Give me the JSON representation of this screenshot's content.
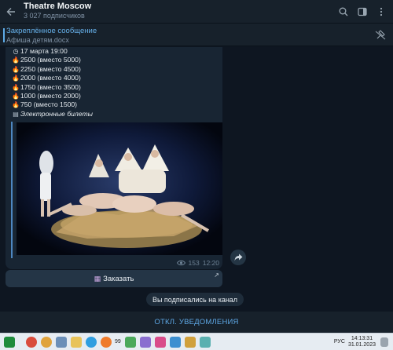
{
  "header": {
    "back_icon": "arrow-left-icon",
    "title": "Theatre Moscow",
    "subtitle": "3 027 подписчиков",
    "icons": [
      "search-icon",
      "sidebar-toggle-icon",
      "more-vertical-icon"
    ]
  },
  "pinned": {
    "title": "Закреплённое сообщение",
    "text": "Афиша детям.docx",
    "icon": "unpin-icon"
  },
  "message": {
    "date_line": "17 марта 19:00",
    "prices": [
      "2500 (вместо 5000)",
      "2250 (вместо 4500)",
      "2000 (вместо 4000)",
      "1750 (вместо 3500)",
      "1000 (вместо 2000)",
      "750 (вместо 1500)"
    ],
    "tickets_text": "Электронные билеты",
    "views": "153",
    "time": "12:20"
  },
  "order_button": {
    "label": "Заказать"
  },
  "service_message": "Вы подписались на канал",
  "bottom_button": "ОТКЛ. УВЕДОМЛЕНИЯ",
  "taskbar": {
    "lang": "РУС",
    "time": "14:13:31",
    "date": "31.01.2023",
    "badge": "99"
  },
  "colors": {
    "background": "#0e1621",
    "panel": "#17212b",
    "bubble": "#182533",
    "accent": "#5ea8e6"
  }
}
